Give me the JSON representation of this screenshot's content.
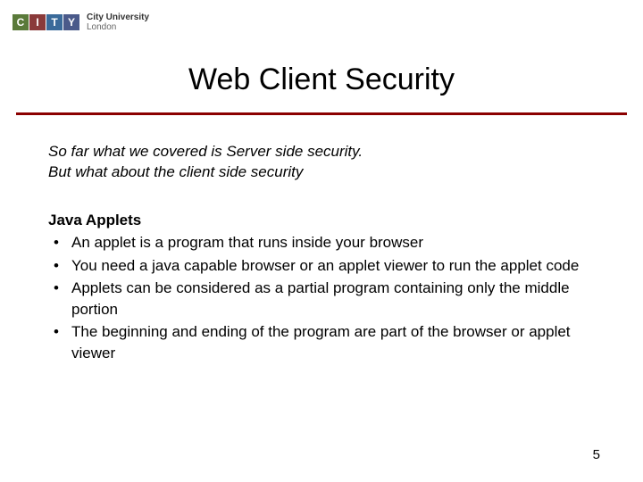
{
  "logo": {
    "letters": [
      "C",
      "I",
      "T",
      "Y"
    ],
    "name_strong": "City University",
    "name_sub": "London"
  },
  "title": "Web Client Security",
  "intro": [
    "So far what we covered is Server side security.",
    "But what about the client side security"
  ],
  "subhead": "Java Applets",
  "bullets": [
    "An applet is a program that runs inside your browser",
    "You need a java capable browser or an applet viewer to run the applet code",
    "Applets can be considered as a partial program containing only the middle portion",
    "The beginning and ending of the program are part of the browser or applet viewer"
  ],
  "page_number": "5"
}
